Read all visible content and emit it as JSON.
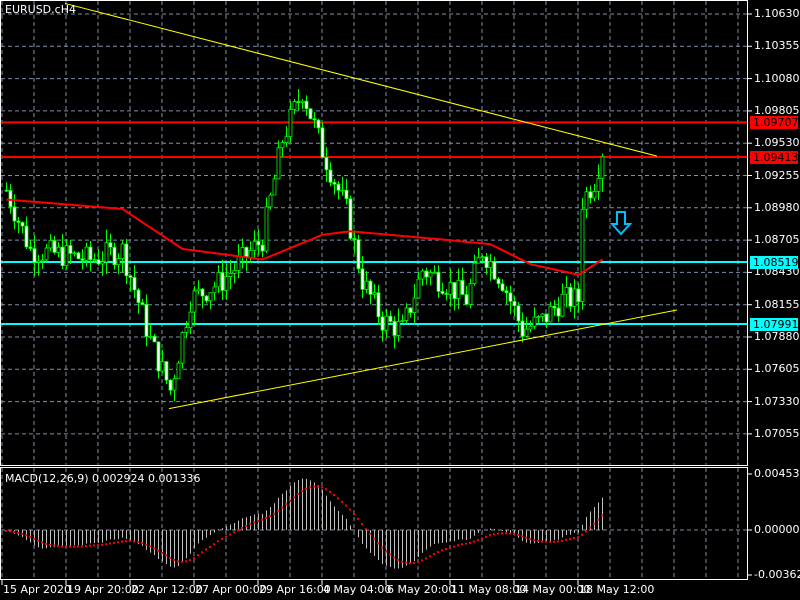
{
  "header": {
    "symbol_title": "EURUSD.cH4"
  },
  "colors": {
    "bull": "#00ff00",
    "line_red": "#ff0000",
    "line_cyan": "#00ffff",
    "trend": "#ffff00",
    "grid": "#7f8fa6",
    "macd_hist": "#c0c0c0",
    "macd_signal": "#ff0000"
  },
  "price_axis": {
    "ticks": [
      "1.10630",
      "1.10355",
      "1.10080",
      "1.09805",
      "1.09530",
      "1.09255",
      "1.08980",
      "1.08705",
      "1.08430",
      "1.08155",
      "1.07880",
      "1.07605",
      "1.07330",
      "1.07055"
    ]
  },
  "levels": [
    {
      "label": "1.09707",
      "price": 1.09707,
      "color": "#ff0000",
      "text_color": "#000000"
    },
    {
      "label": "1.09413",
      "price": 1.09413,
      "color": "#ff0000",
      "text_color": "#000000"
    },
    {
      "label": "1.08519",
      "price": 1.08519,
      "color": "#00ffff",
      "text_color": "#000000"
    },
    {
      "label": "1.07991",
      "price": 1.07991,
      "color": "#00ffff",
      "text_color": "#000000"
    }
  ],
  "time_axis": {
    "labels": [
      "15 Apr 2020",
      "19 Apr 20:00",
      "22 Apr 12:00",
      "27 Apr 00:00",
      "29 Apr 16:00",
      "4 May 04:00",
      "6 May 20:00",
      "11 May 08:00",
      "14 May 00:00",
      "18 May 12:00"
    ]
  },
  "macd": {
    "title": "MACD(12,26,9) 0.002924 0.001336",
    "axis": [
      "0.004534",
      "0.000000",
      "-0.003629"
    ],
    "max": 0.004534,
    "min": -0.003629
  },
  "chart_data": {
    "type": "candlestick",
    "title": "EURUSD.cH4",
    "ylim": [
      1.0688,
      1.1075
    ],
    "bars": 150,
    "close_keypoints": [
      [
        0,
        1.0913
      ],
      [
        6,
        1.0862
      ],
      [
        14,
        1.0858
      ],
      [
        21,
        1.0854
      ],
      [
        29,
        1.0862
      ],
      [
        36,
        1.0785
      ],
      [
        41,
        1.0743
      ],
      [
        46,
        1.082
      ],
      [
        54,
        1.0836
      ],
      [
        64,
        1.0871
      ],
      [
        69,
        1.0956
      ],
      [
        74,
        1.0998
      ],
      [
        79,
        1.0947
      ],
      [
        85,
        1.0896
      ],
      [
        89,
        1.0836
      ],
      [
        94,
        1.0802
      ],
      [
        99,
        1.0794
      ],
      [
        104,
        1.0845
      ],
      [
        109,
        1.0836
      ],
      [
        115,
        1.082
      ],
      [
        119,
        1.0862
      ],
      [
        124,
        1.0836
      ],
      [
        129,
        1.0794
      ],
      [
        134,
        1.0802
      ],
      [
        139,
        1.082
      ],
      [
        143,
        1.082
      ],
      [
        144,
        1.0904
      ],
      [
        147,
        1.0921
      ],
      [
        149,
        1.0947
      ]
    ],
    "ma_keypoints": [
      [
        0,
        1.0905
      ],
      [
        29,
        1.0897
      ],
      [
        44,
        1.0863
      ],
      [
        64,
        1.0854
      ],
      [
        79,
        1.0875
      ],
      [
        86,
        1.0878
      ],
      [
        109,
        1.0871
      ],
      [
        121,
        1.0867
      ],
      [
        131,
        1.085
      ],
      [
        143,
        1.0841
      ],
      [
        149,
        1.0854
      ]
    ],
    "trendlines": [
      {
        "from": [
          15,
          1.1072
        ],
        "to": [
          163,
          1.0942
        ]
      },
      {
        "from": [
          41,
          1.0727
        ],
        "to": [
          168,
          1.0811
        ]
      }
    ]
  }
}
